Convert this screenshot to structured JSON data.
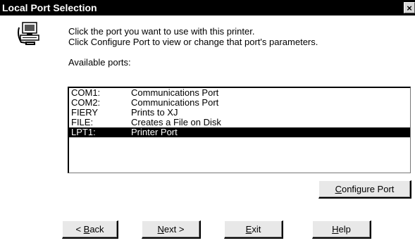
{
  "window": {
    "title": "Local Port Selection",
    "close_glyph": "×"
  },
  "icons": {
    "computer": "computer-ports-icon",
    "close": "close-icon"
  },
  "instructions": {
    "line1": "Click the port you want to use with this printer.",
    "line2": "Click Configure Port to view or change that port's parameters."
  },
  "ports": {
    "label": "Available ports:",
    "items": [
      {
        "name": "COM1:",
        "description": "Communications Port",
        "selected": false
      },
      {
        "name": "COM2:",
        "description": "Communications Port",
        "selected": false
      },
      {
        "name": "FIERY",
        "description": "Prints to XJ",
        "selected": false
      },
      {
        "name": "FILE:",
        "description": "Creates a File on Disk",
        "selected": false
      },
      {
        "name": "LPT1:",
        "description": "Printer Port",
        "selected": true
      }
    ]
  },
  "buttons": {
    "configure": {
      "accel": "C",
      "rest": "onfigure Port"
    },
    "back": {
      "prefix": "< ",
      "accel": "B",
      "rest": "ack"
    },
    "next": {
      "accel": "N",
      "rest": "ext >"
    },
    "exit": {
      "accel": "E",
      "rest": "xit"
    },
    "help": {
      "accel": "H",
      "rest": "elp"
    }
  },
  "colors": {
    "title_bar": "#000000",
    "selection": "#000000",
    "dialog_bg": "#ffffff"
  }
}
